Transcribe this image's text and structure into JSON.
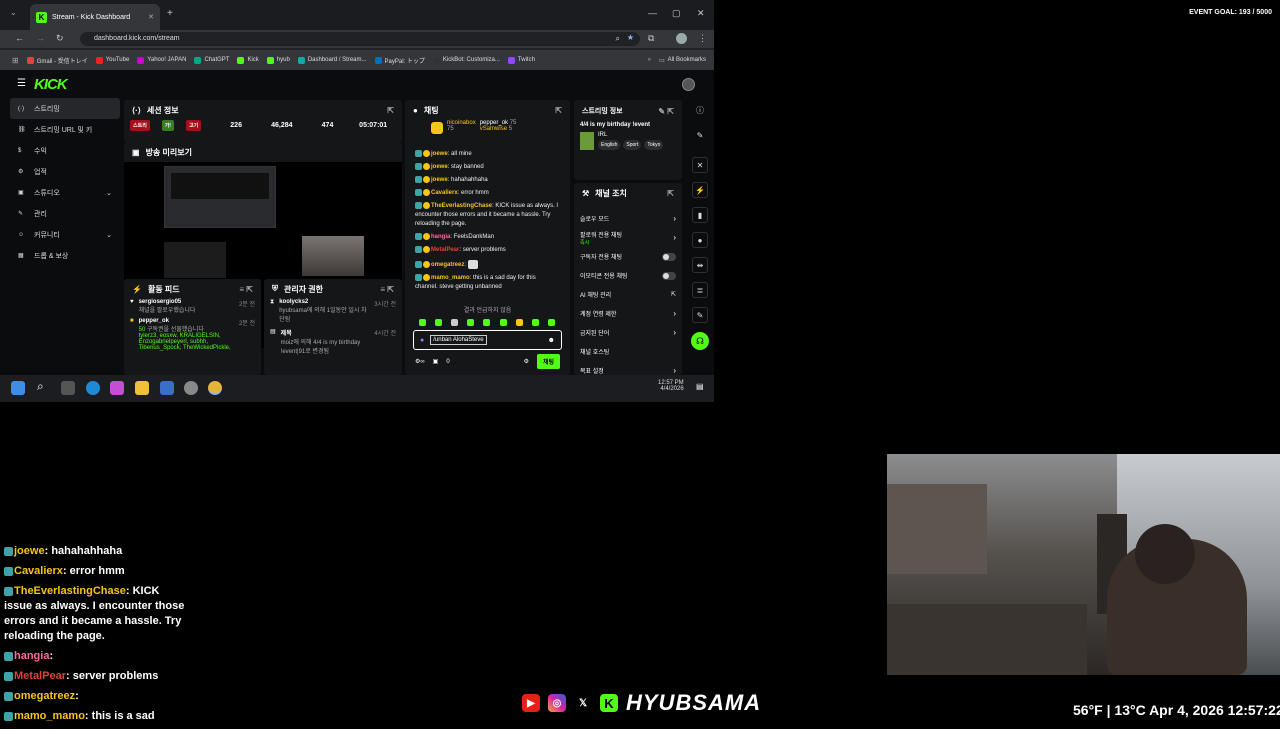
{
  "browser": {
    "tab_title": "Stream - Kick Dashboard",
    "url": "dashboard.kick.com/stream",
    "bookmarks": [
      "Gmail - 受信トレイ",
      "YouTube",
      "Yahoo! JAPAN",
      "ChatGPT",
      "Kick",
      "hyub",
      "Dashboard / Stream...",
      "PayPal: トップ",
      "KickBot: Customiza...",
      "Twitch"
    ],
    "all_bookmarks": "All Bookmarks"
  },
  "dashboard": {
    "logo": "KICK",
    "sidebar": [
      {
        "label": "스트리밍",
        "active": true
      },
      {
        "label": "스트리밍 URL 및 키"
      },
      {
        "label": "수익"
      },
      {
        "label": "업적"
      },
      {
        "label": "스튜디오",
        "chevron": true
      },
      {
        "label": "관리"
      },
      {
        "label": "커뮤니티",
        "chevron": true
      },
      {
        "label": "드롭 & 보상"
      }
    ],
    "session": {
      "title": "세션 정보",
      "badges": [
        "스트리",
        "가!",
        "고기"
      ],
      "stats": [
        "226",
        "46,284",
        "474",
        "05:07:01"
      ]
    },
    "preview_title": "방송 미리보기",
    "activity": {
      "title": "활동 피드",
      "items": [
        {
          "name": "sergiosergio05",
          "text": "채널을 팔로우했습니다",
          "time": "2분 전"
        },
        {
          "name": "pepper_ok",
          "count": "50",
          "text": "구독권을 선물했습니다",
          "users": "tylerz3, eosxw, KRALIGELSIN, Enzogabrielpeyerl, subhh, Tiberius_Spock, TheWickedPickle,",
          "time": "2분 전"
        }
      ]
    },
    "mod": {
      "title": "관리자 권한",
      "items": [
        {
          "name": "koolycks2",
          "text": "hyubsama에 의해 1일동안 일시 차단됨",
          "time": "3시간 전"
        },
        {
          "name": "제목",
          "text": "moiz에 의해 4/4 is my birthday !event|91로 변경됨",
          "time": "4시간 전"
        }
      ]
    },
    "chat": {
      "title": "채팅",
      "gifters": [
        {
          "name": "nicoinabox",
          "n": "75"
        },
        {
          "name": "pepper_ok",
          "n": "75"
        },
        {
          "name": "vSamwise",
          "n": "5"
        }
      ],
      "messages": [
        {
          "user": "joewe",
          "text": "all mine",
          "color": "#f5c518"
        },
        {
          "user": "joewe",
          "text": "stay banned",
          "color": "#f5c518"
        },
        {
          "user": "joewe",
          "text": "hahahahhaha",
          "color": "#f5c518"
        },
        {
          "user": "Cavalierx",
          "text": "error hmm",
          "color": "#f5c518"
        },
        {
          "user": "TheEverlastingChase",
          "text": "KICK issue as always. I encounter those errors and it became a hassle. Try reloading the page.",
          "color": "#f5c518"
        },
        {
          "user": "hangia",
          "text": "FeelsDankMan",
          "color": "#ff6b9e"
        },
        {
          "user": "MetalPear",
          "text": "server problems",
          "color": "#e0413a"
        },
        {
          "user": "omegatreez",
          "text": "",
          "color": "#f5c518"
        },
        {
          "user": "mamo_mamo",
          "text": "this is a sad day for this channel. steve getting unbanned",
          "color": "#f5c518"
        }
      ],
      "no_results": "결과 언급하지 않음",
      "input_value": "/unban AlohaSteve",
      "send": "채팅",
      "count": "0"
    },
    "stream_info": {
      "title": "스트리밍 정보",
      "stream_title": "4/4 is my birthday !event",
      "category": "IRL",
      "tags": [
        "English",
        "Sport",
        "Tokyo"
      ]
    },
    "channel": {
      "title": "채널 조치",
      "items": [
        {
          "label": "슬로우 모드",
          "ctrl": "chev"
        },
        {
          "label": "팔로워 전용 채팅",
          "sub": "즉시",
          "ctrl": "chev"
        },
        {
          "label": "구독자 전용 채팅",
          "ctrl": "toggle"
        },
        {
          "label": "이모티콘 전용 채팅",
          "ctrl": "toggle"
        },
        {
          "label": "AI 채팅 관리",
          "ctrl": "ext"
        },
        {
          "label": "계정 연령 제한",
          "ctrl": "chev"
        },
        {
          "label": "금지된 단어",
          "ctrl": "chev"
        },
        {
          "label": "채널 호스팅",
          "ctrl": "none"
        },
        {
          "label": "목표 설정",
          "ctrl": "chev"
        }
      ]
    }
  },
  "taskbar": {
    "time": "12:57 PM",
    "date": "4/4/2026"
  },
  "overlay": {
    "event_goal": "EVENT GOAL: 193 / 5000",
    "chat": [
      {
        "user": "joewe",
        "text": "hahahahhaha",
        "color": "#f5c518"
      },
      {
        "user": "Cavalierx",
        "text": "error hmm",
        "color": "#f5c518"
      },
      {
        "user": "TheEverlastingChase",
        "text": "KICK issue as always. I encounter those errors and it became a hassle. Try reloading the page.",
        "color": "#f5c518"
      },
      {
        "user": "hangia",
        "text": "",
        "color": "#ff6b9e"
      },
      {
        "user": "MetalPear",
        "text": "server problems",
        "color": "#e0413a"
      },
      {
        "user": "omegatreez",
        "text": "",
        "color": "#f5c518"
      },
      {
        "user": "mamo_mamo",
        "text": "this is a sad",
        "color": "#f5c518"
      }
    ],
    "brand": "HYUBSAMA",
    "weather": "56°F | 13°C   Apr 4, 2026   12:57:22"
  },
  "colors": {
    "kick_green": "#53fc18",
    "panel": "#151618",
    "bg": "#0b0c0d"
  }
}
